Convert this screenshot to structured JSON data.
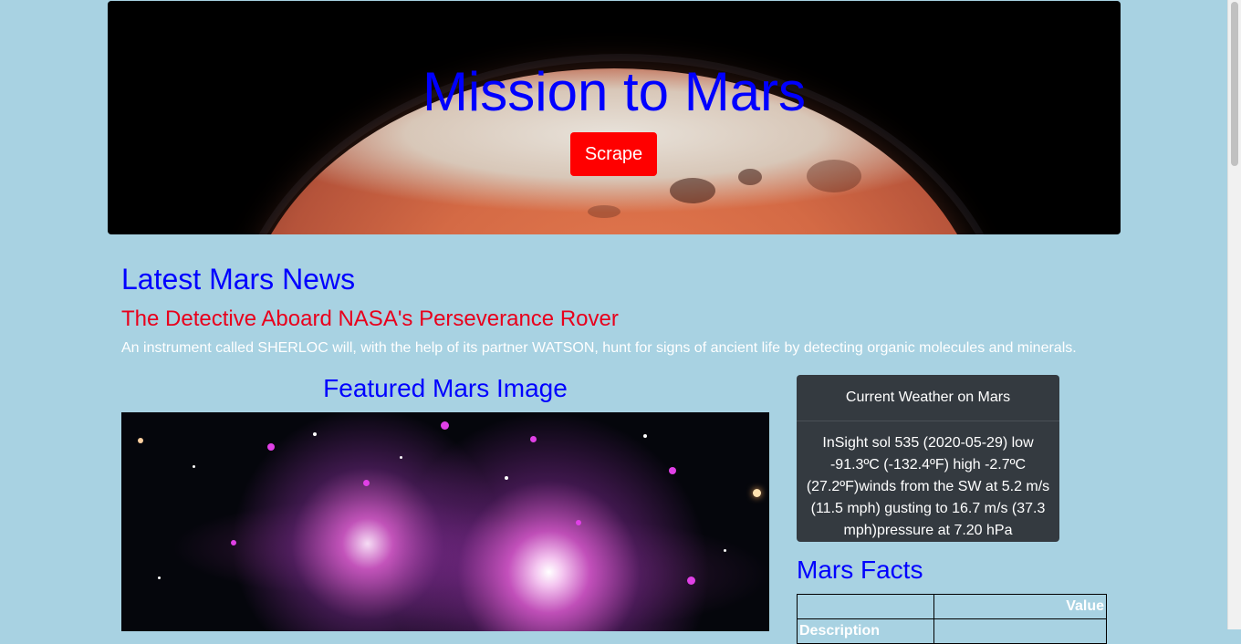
{
  "header": {
    "title": "Mission to Mars",
    "scrape_label": "Scrape"
  },
  "news": {
    "heading": "Latest Mars News",
    "title": "The Detective Aboard NASA's Perseverance Rover",
    "paragraph": "An instrument called SHERLOC will, with the help of its partner WATSON, hunt for signs of ancient life by detecting organic molecules and minerals."
  },
  "featured": {
    "heading": "Featured Mars Image"
  },
  "weather": {
    "header": "Current Weather on Mars",
    "text": "InSight sol 535 (2020-05-29) low -91.3ºC (-132.4ºF) high -2.7ºC (27.2ºF)winds from the SW at 5.2 m/s (11.5 mph) gusting to 16.7 m/s (37.3 mph)pressure at 7.20 hPa"
  },
  "facts": {
    "heading": "Mars Facts",
    "columns": [
      "",
      "Value"
    ],
    "rows": [
      [
        "Description",
        ""
      ]
    ]
  },
  "colors": {
    "page_bg": "#a8d2e2",
    "heading_blue": "#0000ff",
    "news_title_red": "#e8001c",
    "button_red": "#ff0000",
    "card_dark": "#343a40"
  }
}
